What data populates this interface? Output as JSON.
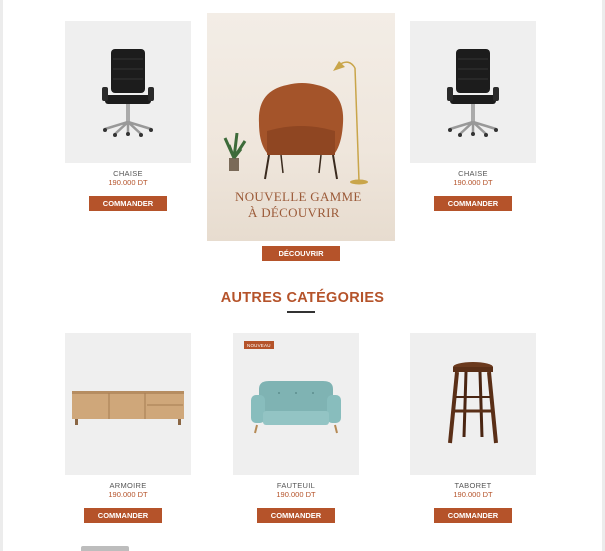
{
  "featured": [
    {
      "name": "CHAISE",
      "price": "190.000 DT",
      "button": "COMMANDER",
      "icon": "office-chair"
    },
    {
      "name": "CHAISE",
      "price": "190.000 DT",
      "button": "COMMANDER",
      "icon": "office-chair"
    }
  ],
  "promo": {
    "line1": "NOUVELLE GAMME",
    "line2": "À DÉCOUVRIR",
    "button": "DÉCOUVRIR"
  },
  "section": {
    "title": "AUTRES CATÉGORIES"
  },
  "categories": [
    {
      "name": "ARMOIRE",
      "price": "190.000 DT",
      "button": "COMMANDER",
      "icon": "sideboard",
      "badge": ""
    },
    {
      "name": "FAUTEUIL",
      "price": "190.000 DT",
      "button": "COMMANDER",
      "icon": "sofa",
      "badge": "NOUVEAU"
    },
    {
      "name": "TABORET",
      "price": "190.000 DT",
      "button": "COMMANDER",
      "icon": "stool",
      "badge": ""
    }
  ],
  "colors": {
    "accent": "#b5532a",
    "card_bg": "#efefef"
  }
}
